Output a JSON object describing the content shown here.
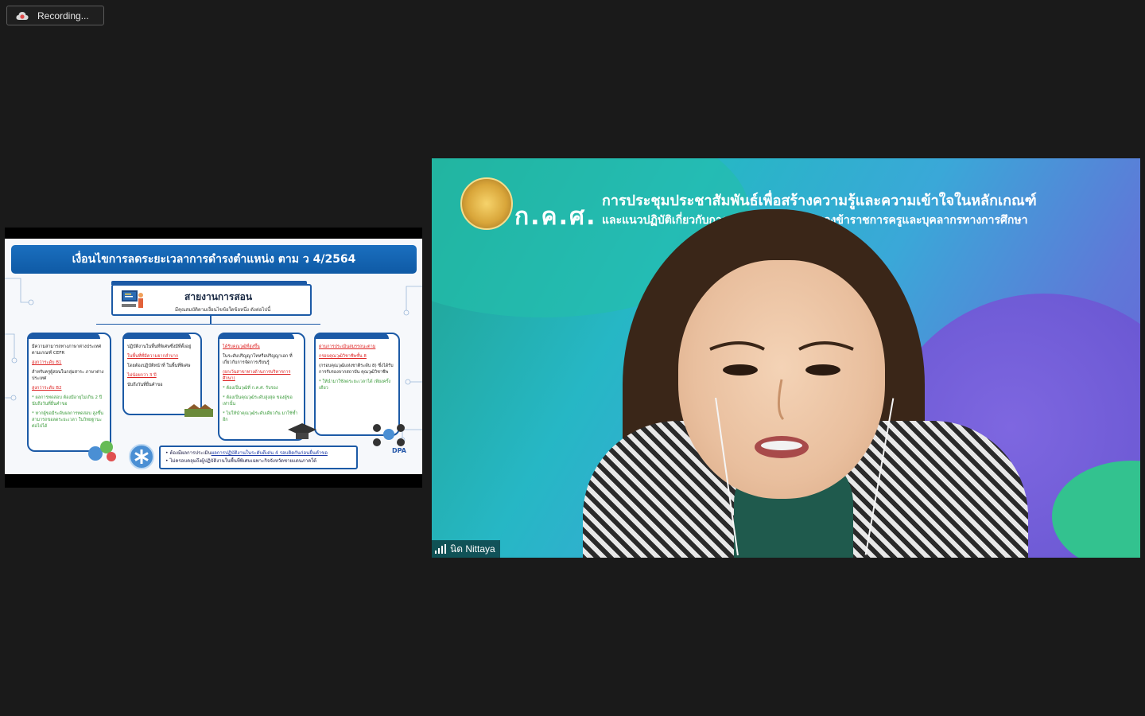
{
  "recording": {
    "label": "Recording..."
  },
  "shared_slide": {
    "title": "เงื่อนไขการลดระยะเวลาการดำรงตำแหน่ง ตาม ว 4/2564",
    "main_box": {
      "title": "สายงานการสอน",
      "subtitle": "มีคุณสมบัติตามเงื่อนไขข้อใดข้อหนึ่ง ดังต่อไปนี้"
    },
    "cards": [
      {
        "lines": [
          "มีความสามารถทางภาษาต่างประเทศ ตามเกณฑ์ CEFR",
          "สูงกว่าระดับ B1",
          "สำหรับครูผู้สอนในกลุ่มสาระ ภาษาต่างประเทศ",
          "สูงกว่าระดับ B2",
          "* ผลการทดสอบ ต้องมีอายุไม่เกิน 2 ปี นับถึงวันที่ยื่นคำขอ",
          "* หากผู้ขอมีระดับผลการทดสอบ สูงขึ้น สามารถขอลดระยะเวลา ในวิทยฐานะต่อไปได้"
        ]
      },
      {
        "lines": [
          "ปฏิบัติงานในพื้นที่พิเศษซึ่งมีที่ตั้งอยู่",
          "ในพื้นที่ที่มีความยากลำบาก",
          "โดยต้องปฏิบัติหน้าที่ ในพื้นที่พิเศษ",
          "ไม่น้อยกว่า 3 ปี",
          "นับถึงวันที่ยื่นคำขอ"
        ]
      },
      {
        "lines": [
          "ได้รับคุณวุฒิที่สูงขึ้น",
          "ในระดับปริญญาโทหรือปริญญาเอก ที่เกี่ยวกับการจัดการเรียนรู้",
          "(ยกเว้นสาขาทางด้านการบริหารการศึกษา)",
          "* ต้องเป็นวุฒิที่ ก.ค.ศ. รับรอง",
          "* ต้องเป็นคุณวุฒิระดับสูงสุด ของผู้ขอเท่านั้น",
          "* ไม่ให้นำคุณวุฒิระดับเดียวกัน มาใช้ซ้ำอีก"
        ]
      },
      {
        "lines": [
          "ผ่านการประเมินสมรรถนะตาม",
          "กรอบคุณวุฒิวิชาชีพชั้น 8",
          "(กรอบคุณวุฒิแห่งชาติระดับ 8) ซึ่งได้รับการรับรองจากสถาบัน คุณวุฒิวิชาชีพ",
          "* ให้นำมาใช้ลดระยะเวลาได้ เพียงครั้งเดียว"
        ]
      }
    ],
    "footnotes": [
      "• ต้องมีผลการประเมิน",
      "ผลการปฏิบัติงานในระดับดีเด่น 4 รอบติดกันก่อนยื่นคำขอ",
      "• ไม่ครอบคลุมถึงผู้ปฏิบัติงานในพื้นที่พิเศษเฉพาะกิจจังหวัดชายแดนภาคใต้"
    ],
    "logo_text": "DPA"
  },
  "video": {
    "org_short": "ก.ค.ศ.",
    "banner_line1": "การประชุมประชาสัมพันธ์เพื่อสร้างความรู้และความเข้าใจในหลักเกณฑ์",
    "banner_line2": "และแนวปฏิบัติเกี่ยวกับการปร... ...วิทยฐานะของข้าราชการครูและบุคลากรทางการศึกษา",
    "participant_name": "นิด Nittaya"
  },
  "colors": {
    "background": "#1a1a1a",
    "slide_blue": "#1c5aa6",
    "recording_icon": "#e04a4a"
  }
}
